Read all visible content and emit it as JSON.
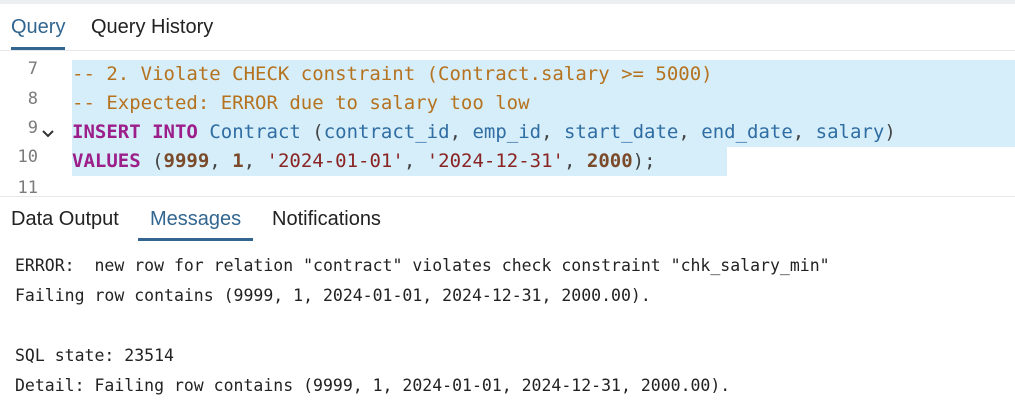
{
  "editor_tabs": [
    "Query",
    "Query History"
  ],
  "editor": {
    "line_numbers": [
      "7",
      "8",
      "9",
      "10",
      "11"
    ],
    "lines": [
      [
        {
          "t": "-- 2. Violate CHECK constraint (Contract.salary >= 5000)",
          "c": "tok-cmt"
        }
      ],
      [
        {
          "t": "-- Expected: ERROR due to salary too low",
          "c": "tok-cmt"
        }
      ],
      [
        {
          "t": "INSERT",
          "c": "tok-kw"
        },
        {
          "t": " ",
          "c": "tok-punc"
        },
        {
          "t": "INTO",
          "c": "tok-kw"
        },
        {
          "t": " ",
          "c": "tok-punc"
        },
        {
          "t": "Contract",
          "c": "tok-id"
        },
        {
          "t": " (",
          "c": "tok-punc"
        },
        {
          "t": "contract_id",
          "c": "tok-id"
        },
        {
          "t": ", ",
          "c": "tok-punc"
        },
        {
          "t": "emp_id",
          "c": "tok-id"
        },
        {
          "t": ", ",
          "c": "tok-punc"
        },
        {
          "t": "start_date",
          "c": "tok-id"
        },
        {
          "t": ", ",
          "c": "tok-punc"
        },
        {
          "t": "end_date",
          "c": "tok-id"
        },
        {
          "t": ", ",
          "c": "tok-punc"
        },
        {
          "t": "salary",
          "c": "tok-id"
        },
        {
          "t": ")",
          "c": "tok-punc"
        }
      ],
      [
        {
          "t": "VALUES",
          "c": "tok-kw"
        },
        {
          "t": " (",
          "c": "tok-punc"
        },
        {
          "t": "9999",
          "c": "tok-num"
        },
        {
          "t": ", ",
          "c": "tok-punc"
        },
        {
          "t": "1",
          "c": "tok-num"
        },
        {
          "t": ", ",
          "c": "tok-punc"
        },
        {
          "t": "'2024-01-01'",
          "c": "tok-str"
        },
        {
          "t": ", ",
          "c": "tok-punc"
        },
        {
          "t": "'2024-12-31'",
          "c": "tok-str"
        },
        {
          "t": ", ",
          "c": "tok-punc"
        },
        {
          "t": "2000",
          "c": "tok-num"
        },
        {
          "t": ");",
          "c": "tok-punc"
        }
      ]
    ],
    "fold_icon": "chevron-down-icon",
    "highlight_color": "#d6eef9"
  },
  "result_tabs": [
    "Data Output",
    "Messages",
    "Notifications"
  ],
  "messages": [
    "ERROR:  new row for relation \"contract\" violates check constraint \"chk_salary_min\"",
    "Failing row contains (9999, 1, 2024-01-01, 2024-12-31, 2000.00).",
    "",
    "SQL state: 23514",
    "Detail: Failing row contains (9999, 1, 2024-01-01, 2024-12-31, 2000.00)."
  ],
  "colors": {
    "accent": "#326690",
    "comment": "#b5721f",
    "keyword": "#9c1e8a",
    "identifier": "#2f6da3"
  }
}
